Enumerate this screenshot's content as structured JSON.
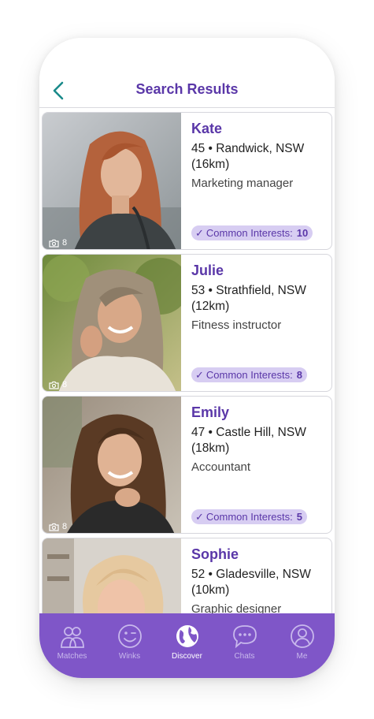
{
  "header": {
    "title": "Search Results",
    "back_icon": "chevron-left-icon"
  },
  "results": [
    {
      "name": "Kate",
      "location": "45 • Randwick, NSW",
      "distance": "(16km)",
      "job": "Marketing manager",
      "photo_count": "8",
      "interests_label": "Common Interests:",
      "interests_count": "10"
    },
    {
      "name": "Julie",
      "location": "53 • Strathfield, NSW",
      "distance": "(12km)",
      "job": "Fitness instructor",
      "photo_count": "8",
      "interests_label": "Common Interests:",
      "interests_count": "8"
    },
    {
      "name": "Emily",
      "location": "47 • Castle Hill, NSW",
      "distance": "(18km)",
      "job": "Accountant",
      "photo_count": "8",
      "interests_label": "Common Interests:",
      "interests_count": "5"
    },
    {
      "name": "Sophie",
      "location": "52 • Gladesville, NSW",
      "distance": "(10km)",
      "job": "Graphic designer"
    }
  ],
  "tabs": [
    {
      "label": "Matches",
      "icon": "people-icon"
    },
    {
      "label": "Winks",
      "icon": "wink-icon"
    },
    {
      "label": "Discover",
      "icon": "globe-icon",
      "active": true
    },
    {
      "label": "Chats",
      "icon": "chat-bubble-icon"
    },
    {
      "label": "Me",
      "icon": "profile-icon"
    }
  ],
  "colors": {
    "brand": "#5a37a8",
    "tabbar": "#7f56c8",
    "pill": "#d7cdf2",
    "back_chevron": "#1a8a8a"
  }
}
